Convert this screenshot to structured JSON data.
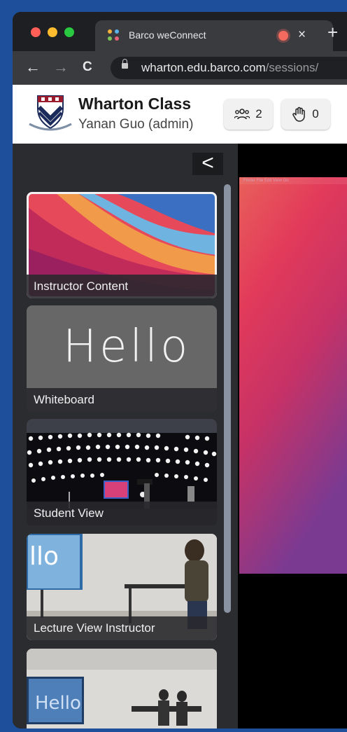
{
  "browser": {
    "tab_title": "Barco weConnect",
    "tab_close": "×",
    "new_tab": "+",
    "back": "←",
    "forward": "→",
    "reload": "C",
    "url_host": "wharton.edu.barco.com",
    "url_path": "/sessions/"
  },
  "header": {
    "class_name": "Wharton Class",
    "user": "Yanan Guo (admin)",
    "participants_count": "2",
    "hands_raised": "0"
  },
  "sidebar": {
    "collapse_label": "<",
    "cards": [
      {
        "label": "Instructor Content"
      },
      {
        "label": "Whiteboard"
      },
      {
        "label": "Student View"
      },
      {
        "label": "Lecture View Instructor"
      }
    ],
    "whiteboard_text": "Hello"
  },
  "stage": {
    "menu_bar": "Finder  File  Edit  View  Go"
  },
  "colors": {
    "accent_red": "#f46a5e",
    "sidebar_bg": "#2b2c2f"
  }
}
